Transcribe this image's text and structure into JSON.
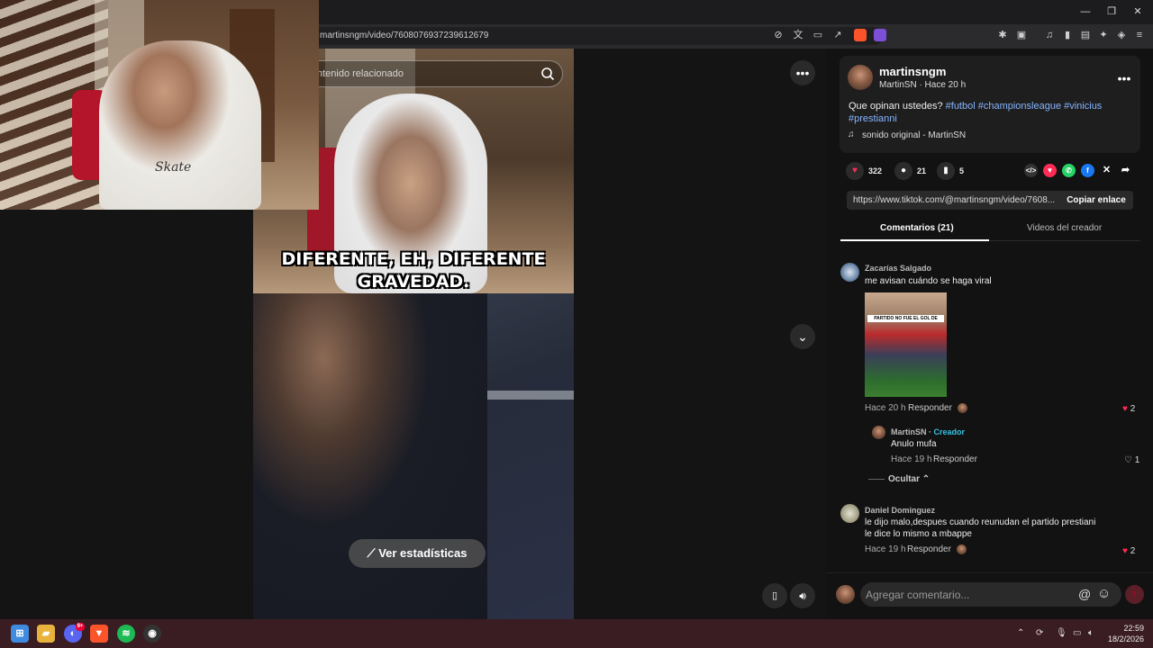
{
  "browser": {
    "url": "martinsngm/video/7608076937239612679",
    "window_controls": [
      "—",
      "❐",
      "✕"
    ]
  },
  "search": {
    "placeholder": "ntenido relacionado"
  },
  "video": {
    "caption_line1": "DIFERENTE, EH, DIFERENTE",
    "caption_line2": "GRAVEDAD.",
    "stats_button": "Ver estadísticas"
  },
  "webcam": {
    "shirt_text": "Skate"
  },
  "post": {
    "author": "martinsngm",
    "author_sub": "MartinSN · Hace 20 h",
    "description_plain": "Que opinan ustedes? ",
    "hashtags": "#futbol #championsleague #vinicius #prestianni",
    "sound": "sonido original - MartinSN"
  },
  "actions": {
    "likes": "322",
    "comments": "21",
    "saves": "5"
  },
  "link": {
    "url": "https://www.tiktok.com/@martinsngm/video/7608...",
    "copy_label": "Copiar enlace"
  },
  "tabs": {
    "comments": "Comentarios (21)",
    "creator_videos": "Videos del creador"
  },
  "comments": [
    {
      "name": "Zacarías Salgado",
      "text": "me avisan cuándo se haga viral",
      "image_label": "PARTIDO NO FUE EL GOL DE",
      "time": "Hace 20 h",
      "reply_label": "Responder",
      "likes": "2"
    },
    {
      "name": "MartinSN",
      "badge": "Creador",
      "text": "Anulo mufa",
      "time": "Hace 19 h",
      "reply_label": "Responder",
      "likes": "1"
    },
    {
      "name": "Daniel Dominguez",
      "text_line1": "le dijo malo,despues cuando reunudan el partido prestiani",
      "text_line2": "le dice lo mismo a mbappe",
      "time": "Hace 19 h",
      "reply_label": "Responder",
      "likes": "2"
    }
  ],
  "hide_replies": "Ocultar",
  "comment_input": {
    "placeholder": "Agregar comentario..."
  },
  "taskbar": {
    "discord_badge": "9+",
    "time": "22:59",
    "date": "18/2/2026"
  },
  "colors": {
    "accent": "#fe2c55",
    "hashtag": "#86b5ff",
    "taskbar": "#3a1d22"
  }
}
